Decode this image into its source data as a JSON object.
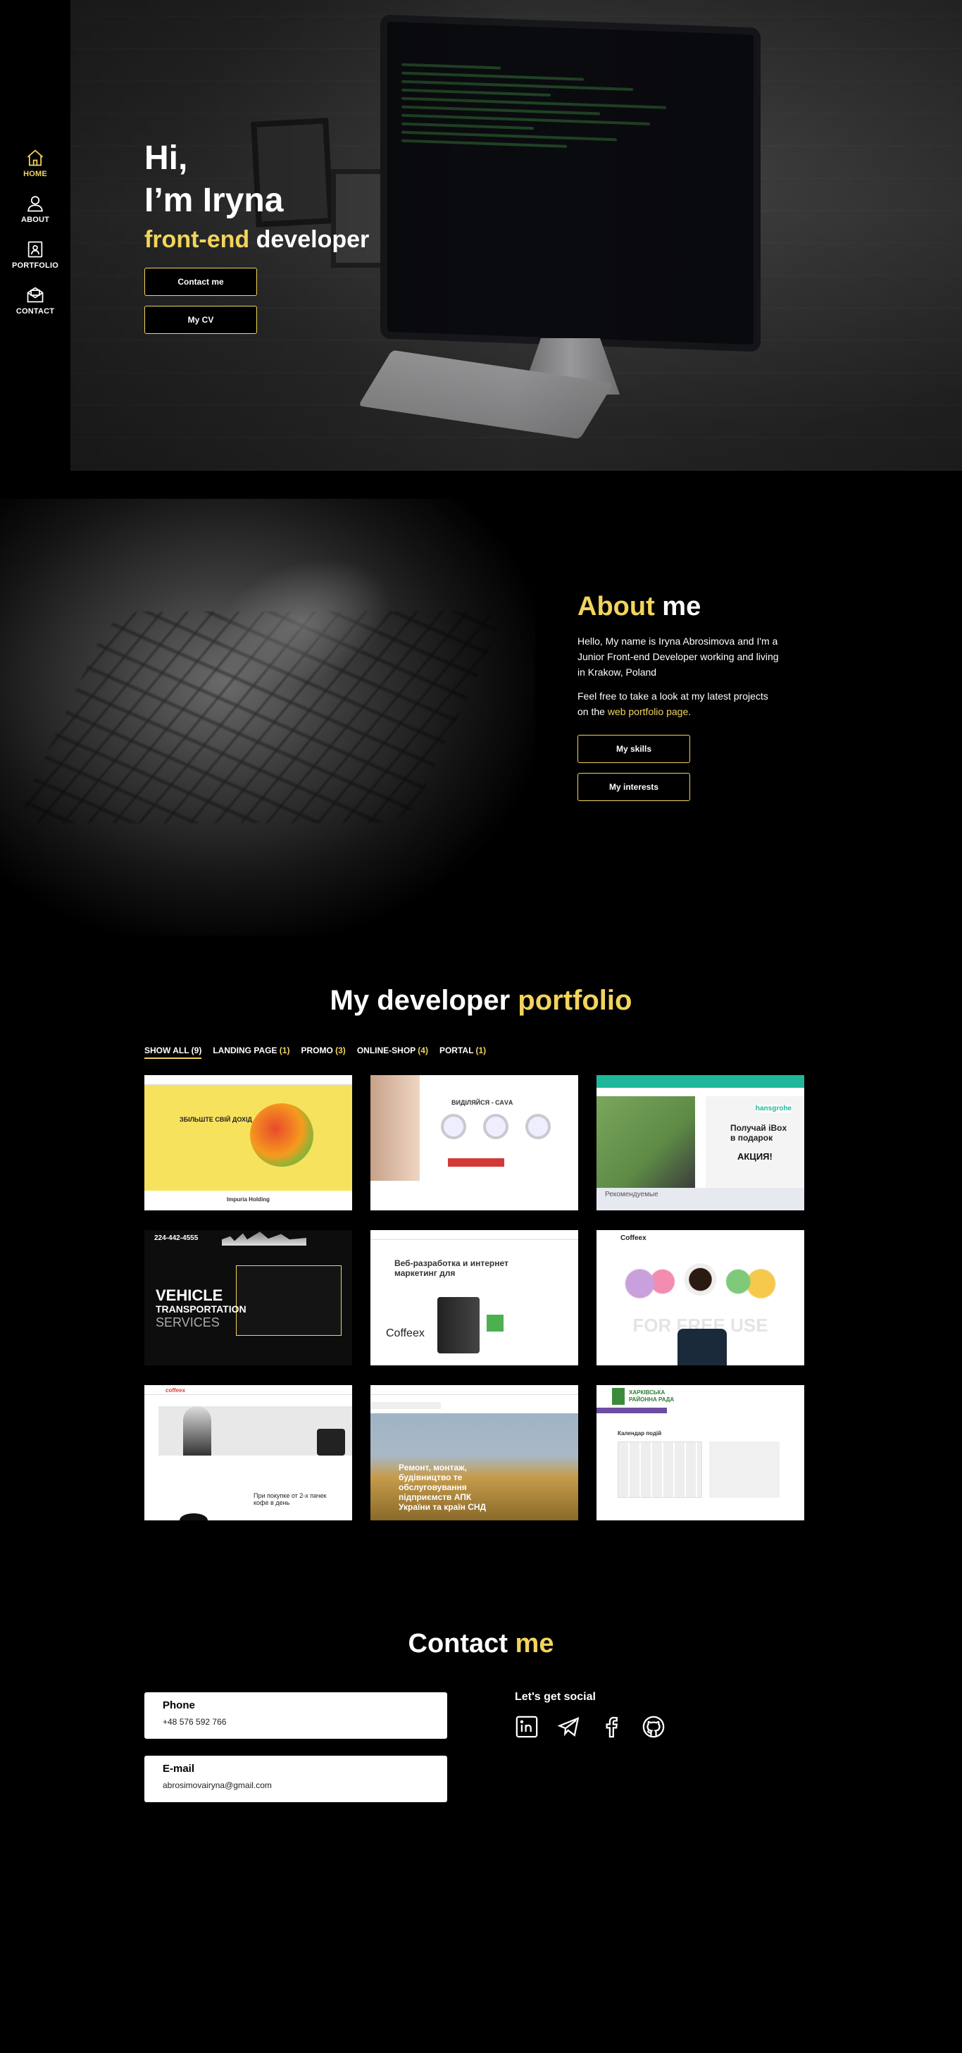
{
  "nav": {
    "items": [
      {
        "label": "HOME",
        "icon": "home-icon",
        "active": true
      },
      {
        "label": "ABOUT",
        "icon": "user-icon"
      },
      {
        "label": "PORTFOLIO",
        "icon": "portfolio-icon"
      },
      {
        "label": "CONTACT",
        "icon": "contact-icon"
      }
    ]
  },
  "hero": {
    "greeting": "Hi,",
    "name": "I’m Iryna",
    "role_accent": "front-end",
    "role_rest": " developer",
    "buttons": {
      "contact": "Contact me",
      "cv": "My CV"
    }
  },
  "about": {
    "title_accent": "About",
    "title_rest": " me",
    "intro": "Hello, My name is Iryna Abrosimova and I'm a Junior Front-end Developer working and living in Krakow, Poland",
    "cta_before": "Feel free to take a look at my latest projects on the ",
    "cta_link": "web portfolio page",
    "cta_after": ".",
    "buttons": {
      "skills": "My skills",
      "interests": "My interests"
    }
  },
  "portfolio": {
    "title_before": "My developer ",
    "title_accent": "portfolio",
    "filters": [
      {
        "label": "SHOW ALL ",
        "count": "(9)",
        "active": true
      },
      {
        "label": "LANDING PAGE ",
        "count": "(1)"
      },
      {
        "label": "PROMO ",
        "count": "(3)"
      },
      {
        "label": "ONLINE-SHOP ",
        "count": "(4)"
      },
      {
        "label": "PORTAL ",
        "count": "(1)"
      }
    ],
    "cards": {
      "c1": {
        "headline": "ЗБІЛЬШТЕ СВІЙ ДОХІД",
        "footer": "Impuria Holding"
      },
      "c2": {
        "headline": "ВИДІЛЯЙСЯ - САVА"
      },
      "c3": {
        "brand": "hansgrohe",
        "promo": "Получай iBox в подарок",
        "promo2": "АКЦИЯ!",
        "bottom": "Рекомендуемые"
      },
      "c4": {
        "phone": "224-442-4555",
        "title1": "VEHICLE",
        "title2": "TRANSPORTATION",
        "title3": "SERVICES"
      },
      "c5": {
        "headline": "Веб-разработка и интернет маркетинг для",
        "brand": "Coffeex"
      },
      "c6": {
        "brand": "Coffeex",
        "watermark": "FOR FREE USE"
      },
      "c7": {
        "brand": "coffeex",
        "text": "При покупке от 2-х пачек кофе в день"
      },
      "c8": {
        "text": "Ремонт, монтаж, будівництво те обслуговування підприємств АПК України та країн СНД"
      },
      "c9": {
        "title": "ХАРКІВСЬКА РАЙОННА РАДА",
        "section": "Календар подій"
      }
    }
  },
  "contact": {
    "title_before": "Contact ",
    "title_accent": "me",
    "phone_label": "Phone",
    "phone_value": "+48 576 592 766",
    "email_label": "E-mail",
    "email_value": "abrosimovairyna@gmail.com",
    "social_title": "Let's get social",
    "social": [
      "linkedin-icon",
      "telegram-icon",
      "facebook-icon",
      "github-icon"
    ]
  },
  "colors": {
    "accent": "#f2d45c",
    "background": "#000000",
    "text": "#ffffff"
  }
}
